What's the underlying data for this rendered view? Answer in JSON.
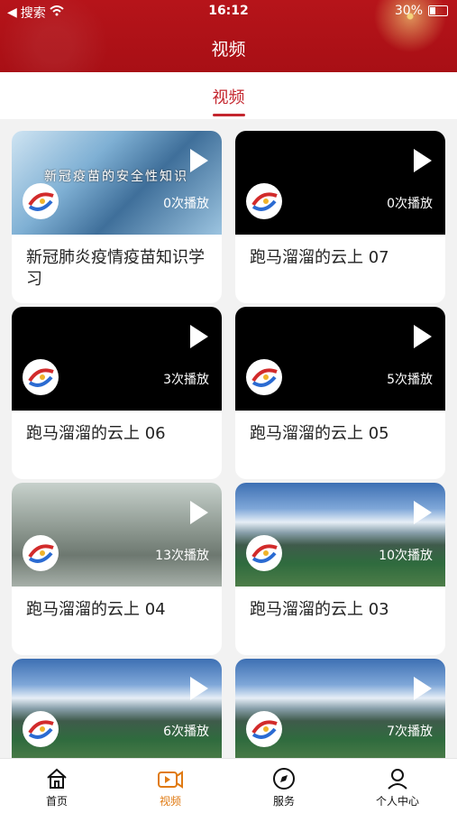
{
  "status": {
    "left": "搜索",
    "time": "16:12",
    "battery": "30%"
  },
  "header": {
    "title": "视频"
  },
  "tabs": [
    {
      "label": "视频"
    }
  ],
  "videos": [
    {
      "title": "新冠肺炎疫情疫苗知识学习",
      "plays": "0次播放",
      "overlay": "新冠疫苗的安全性知识"
    },
    {
      "title": "跑马溜溜的云上 07",
      "plays": "0次播放"
    },
    {
      "title": "跑马溜溜的云上 06",
      "plays": "3次播放"
    },
    {
      "title": "跑马溜溜的云上 05",
      "plays": "5次播放"
    },
    {
      "title": "跑马溜溜的云上 04",
      "plays": "13次播放"
    },
    {
      "title": "跑马溜溜的云上 03",
      "plays": "10次播放"
    },
    {
      "title": "",
      "plays": "6次播放"
    },
    {
      "title": "",
      "plays": "7次播放"
    }
  ],
  "bottom_nav": [
    {
      "label": "首页",
      "icon": "home-icon"
    },
    {
      "label": "视频",
      "icon": "video-icon"
    },
    {
      "label": "服务",
      "icon": "compass-icon"
    },
    {
      "label": "个人中心",
      "icon": "user-icon"
    }
  ],
  "colors": {
    "brand": "#c4262e",
    "active": "#e07a12"
  }
}
